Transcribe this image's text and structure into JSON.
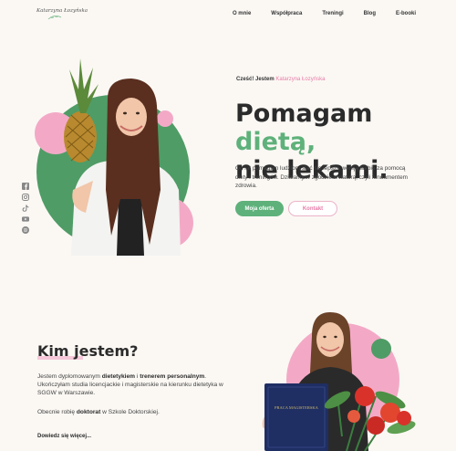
{
  "header": {
    "logo_text": "Katarzyna Łozyńska",
    "nav": [
      "O mnie",
      "Współpraca",
      "Treningi",
      "Blog",
      "E-booki"
    ]
  },
  "hero": {
    "greeting_prefix": "Cześć! Jestem",
    "greeting_name": "Katarzyna Łozyńska",
    "headline_part1": "Pomagam",
    "headline_accent": "dietą,",
    "headline_line2": "nie lekami.",
    "lead": "Od lat pomagam ludziom stać się lepszą wersją siebie za pomocą diety i treningów. Działamy w zgodzie w naturą, czyli fundamentem zdrowia.",
    "primary_button": "Moja oferta",
    "secondary_button": "Kontakt"
  },
  "social": [
    "facebook-icon",
    "instagram-icon",
    "tiktok-icon",
    "youtube-icon",
    "spotify-icon"
  ],
  "about": {
    "title": "Kim jestem?",
    "p1_before": "Jestem dyplomowanym",
    "p1_bold1": "dietetykiem",
    "p1_mid": "i",
    "p1_bold2": "trenerem personalnym",
    "p1_after": ". Ukończyłam studia licencjackie i magisterskie na kierunku dietetyka w SGGW w Warszawie.",
    "p2_before": "Obecnie robię",
    "p2_bold": "doktorat",
    "p2_after": "w Szkole Doktorskiej.",
    "more_link": "Dowiedz się więcej...",
    "diploma_text": "PRACA MAGISTERSKA"
  },
  "colors": {
    "green": "#5eb17a",
    "pink": "#f3a9c6",
    "accent_pink": "#e87ba8",
    "background": "#fbf8f4"
  }
}
